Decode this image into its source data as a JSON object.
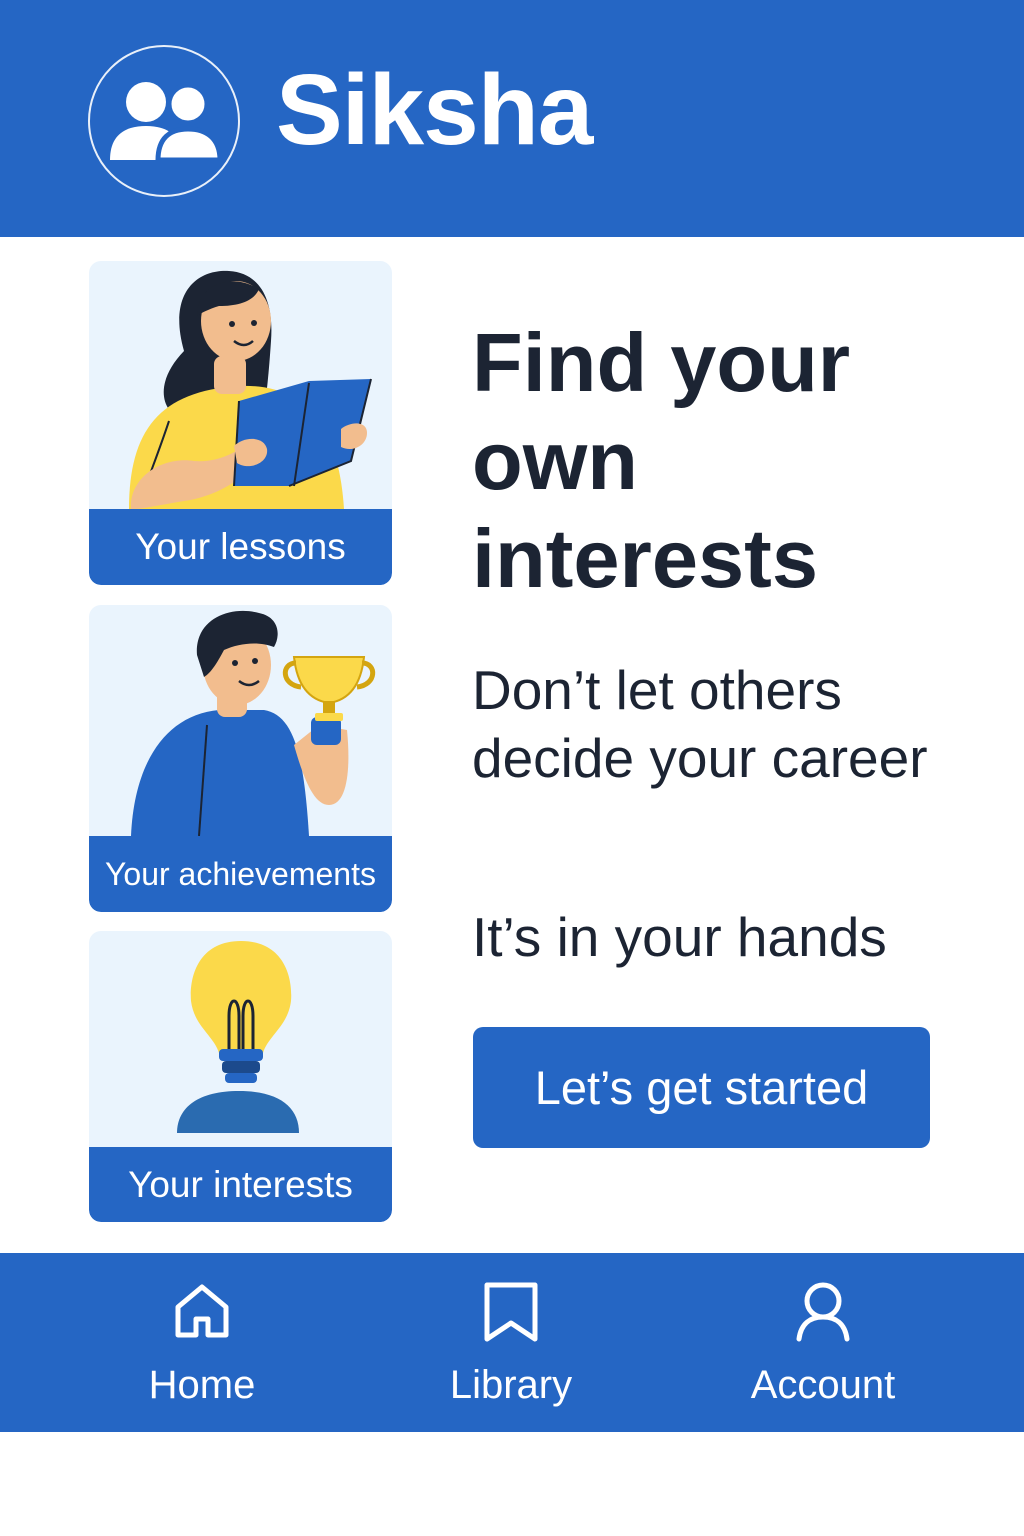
{
  "header": {
    "app_name": "Siksha",
    "logo_icon": "users-group-icon",
    "background_color": "#2566c4"
  },
  "cards": [
    {
      "label": "Your lessons",
      "icon": "reading-person-illustration"
    },
    {
      "label": "Your achievements",
      "icon": "trophy-person-illustration"
    },
    {
      "label": "Your interests",
      "icon": "lightbulb-illustration"
    }
  ],
  "main": {
    "headline": "Find your own interests",
    "subline": "Don’t let others decide your career",
    "tagline": "It’s in your hands",
    "cta_label": "Let’s get started"
  },
  "nav": {
    "items": [
      {
        "label": "Home",
        "icon": "home-icon"
      },
      {
        "label": "Library",
        "icon": "bookmark-icon"
      },
      {
        "label": "Account",
        "icon": "user-icon"
      }
    ]
  },
  "colors": {
    "accent": "#2566c4",
    "card_background": "#eaf4fd",
    "text_dark": "#1c2433",
    "highlight_yellow": "#fbd94a"
  }
}
